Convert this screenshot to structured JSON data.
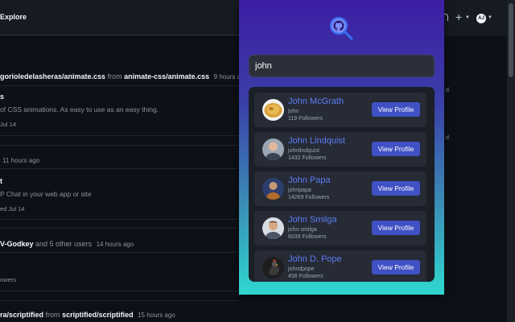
{
  "github": {
    "nav_explore": "Explore",
    "avatar_initials": "AJ",
    "feed": [
      {
        "actor": "gorioledelasheras/animate.css",
        "from_word": "from",
        "repo": "animate-css/animate.css",
        "time": "9 hours ago"
      },
      {
        "desc": "of CSS animations. As easy to use as an easy thing.",
        "meta": "Jul 14"
      },
      {
        "time": "11 hours ago"
      },
      {
        "desc": "P Chat in your web app or site",
        "meta": "ed Jul 14"
      },
      {
        "actor": "V-Godkey",
        "suffix": "and 5 other users",
        "time": "14 hours ago"
      },
      {
        "meta": "owers"
      },
      {
        "actor": "ra/scriptified",
        "from_word": "from",
        "repo": "scriptified/scriptified",
        "time": "15 hours ago"
      }
    ],
    "side_fragment": "d"
  },
  "popup": {
    "logo_icon": "github-search-icon",
    "search": {
      "value": "john",
      "placeholder": ""
    },
    "button_label": "View Profile",
    "users": [
      {
        "name": "John McGrath",
        "login": "john",
        "followers": "119 Followers",
        "avatar": "food-bowl"
      },
      {
        "name": "John Lindquist",
        "login": "johnlindquist",
        "followers": "1432 Followers",
        "avatar": "person-portrait"
      },
      {
        "name": "John Papa",
        "login": "johnpapa",
        "followers": "14269 Followers",
        "avatar": "person-portrait"
      },
      {
        "name": "John Smilga",
        "login": "john-smilga",
        "followers": "6039 Followers",
        "avatar": "person-portrait"
      },
      {
        "name": "John D. Pope",
        "login": "johndpope",
        "followers": "456 Followers",
        "avatar": "rooster"
      }
    ]
  },
  "colors": {
    "accent": "#5d7cf5",
    "button": "#3f51c4",
    "gradient_top": "#3d1da3",
    "gradient_bottom": "#2fd8cf"
  }
}
